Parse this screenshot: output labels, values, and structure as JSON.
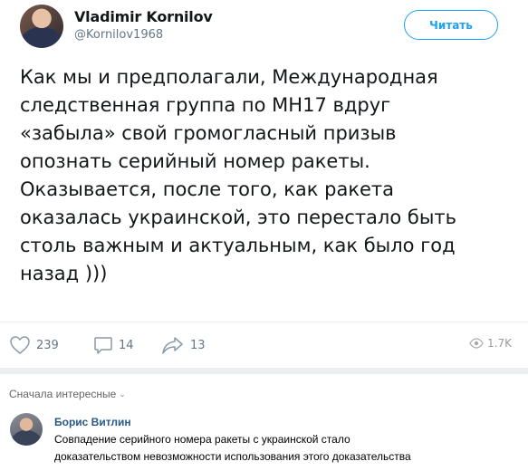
{
  "post": {
    "author_name": "Vladimir Kornilov",
    "author_handle": "@Kornilov1968",
    "follow_label": "Читать",
    "text_lines": [
      "Как мы и предполагали, Международная",
      "следственная группа по МН17 вдруг",
      "«забыла» свой громогласный призыв",
      "опознать серийный номер ракеты.",
      "Оказывается, после того, как ракета",
      "оказалась украинской, это перестало быть",
      "столь важным и актуальным, как было год",
      "назад )))"
    ],
    "actions": {
      "likes": "239",
      "replies": "14",
      "shares": "13",
      "views": "1.7K"
    },
    "icons": {
      "like": "heart-icon",
      "reply": "comment-icon",
      "share": "share-arrow-icon",
      "views": "eye-icon"
    }
  },
  "comments": {
    "sort_label": "Сначала интересные",
    "items": [
      {
        "author": "Борис Витлин",
        "text_lines": [
          "Совпадение серийного номера ракеты с украинской стало",
          "доказательством невозможности использования этого доказательства"
        ]
      }
    ]
  },
  "colors": {
    "accent": "#1da1f2",
    "muted": "#657786",
    "comment_author": "#2a5885",
    "band": "#edeef0"
  }
}
